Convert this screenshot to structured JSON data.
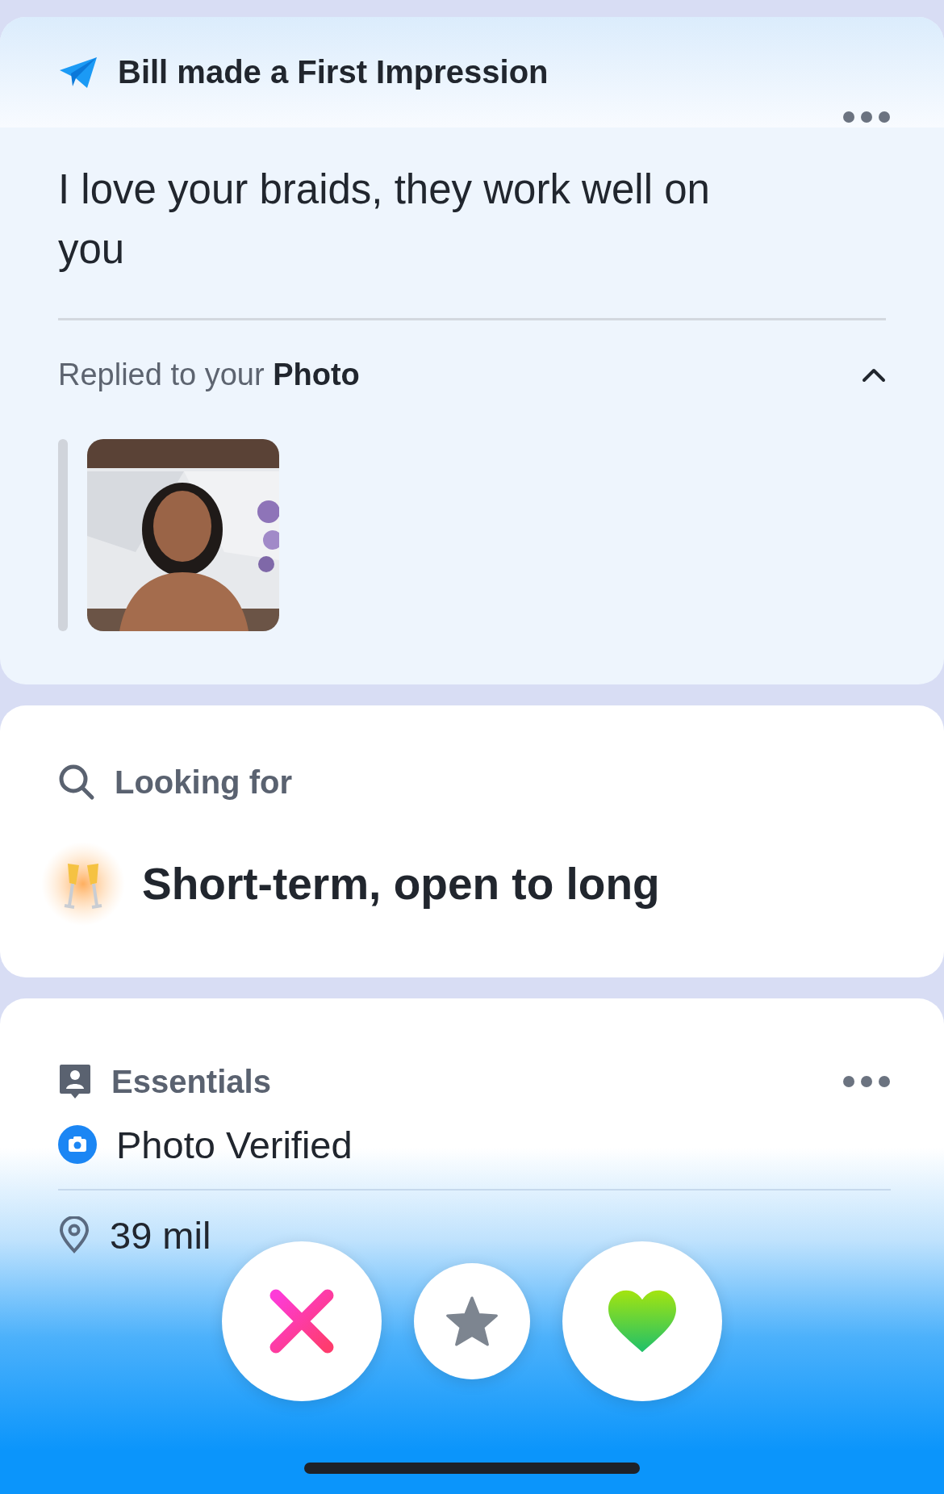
{
  "header": {
    "title": "Bill made a First Impression"
  },
  "message": "I love your braids, they work well on you",
  "reply": {
    "text": "Replied to your **Photo**",
    "expanded": true
  },
  "looking_for": {
    "heading": "Looking for",
    "value": "Short-term, open to long"
  },
  "essentials": {
    "heading": "Essentials",
    "items": [
      {
        "kind": "verified",
        "text": "Photo Verified"
      },
      {
        "kind": "distance",
        "text": "39 mil"
      }
    ]
  },
  "actions": [
    {
      "kind": "nope"
    },
    {
      "kind": "super_like"
    },
    {
      "kind": "like"
    }
  ]
}
